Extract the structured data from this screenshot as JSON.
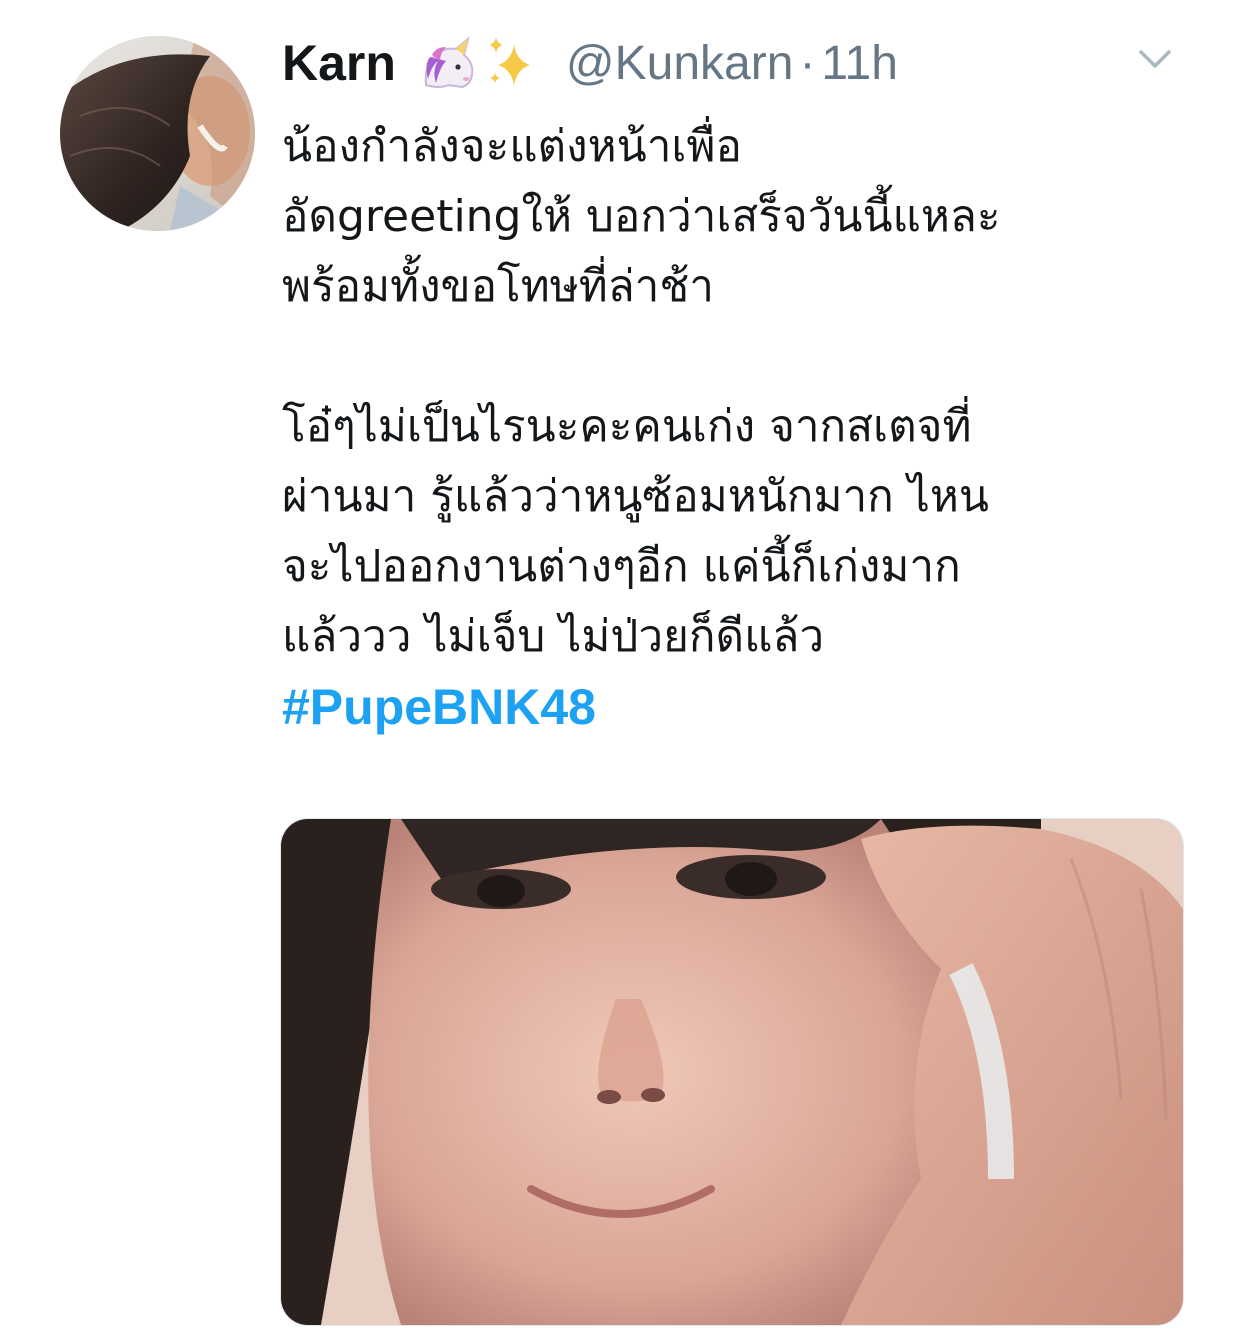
{
  "tweet": {
    "display_name": "Karn",
    "name_emojis": [
      "unicorn-icon",
      "sparkles-icon"
    ],
    "handle": "@Kunkarn",
    "separator": "·",
    "time": "11h",
    "text_lines": [
      "น้องกำลังจะแต่งหน้าเพื่อ",
      "อัดgreetingให้ บอกว่าเสร็จวันนี้แหละ",
      "พร้อมทั้งขอโทษที่ล่าช้า",
      "",
      "โอ๋ๆไม่เป็นไรนะคะคนเก่ง จากสเตจที่",
      "ผ่านมา รู้แล้วว่าหนูซ้อมหนักมาก ไหน",
      "จะไปออกงานต่างๆอีก แค่นี้ก็เก่งมาก",
      "แล้ววว ไม่เจ็บ ไม่ป่วยก็ดีแล้ว"
    ],
    "hashtag": "#PupeBNK48",
    "more_icon": "chevron-down-icon",
    "colors": {
      "text": "#14171a",
      "secondary": "#657786",
      "link": "#1da1f2",
      "caret": "#aab8c2"
    }
  }
}
